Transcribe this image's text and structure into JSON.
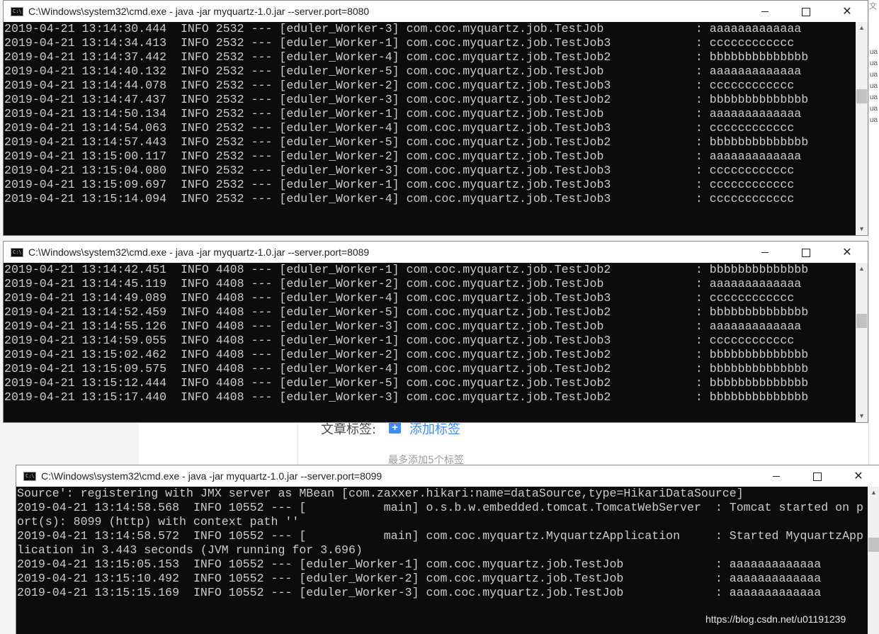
{
  "background": {
    "tags_label": "文章标签:",
    "add_tag_icon": "plus-icon",
    "add_tag_label": "添加标签",
    "tag_hint": "最多添加5个标签",
    "right_edge_crumb": "文",
    "right_edge_items": [
      "ua",
      "ua",
      "ua",
      "ua",
      "ua",
      "ua",
      "ua"
    ]
  },
  "windows": [
    {
      "title": "C:\\Windows\\system32\\cmd.exe - java  -jar myquartz-1.0.jar --server.port=8080",
      "lines": [
        "2019-04-21 13:14:30.444  INFO 2532 --- [eduler_Worker-3] com.coc.myquartz.job.TestJob             : aaaaaaaaaaaaa",
        "2019-04-21 13:14:34.413  INFO 2532 --- [eduler_Worker-1] com.coc.myquartz.job.TestJob3            : cccccccccccc",
        "2019-04-21 13:14:37.442  INFO 2532 --- [eduler_Worker-4] com.coc.myquartz.job.TestJob2            : bbbbbbbbbbbbbb",
        "2019-04-21 13:14:40.132  INFO 2532 --- [eduler_Worker-5] com.coc.myquartz.job.TestJob             : aaaaaaaaaaaaa",
        "2019-04-21 13:14:44.078  INFO 2532 --- [eduler_Worker-2] com.coc.myquartz.job.TestJob3            : cccccccccccc",
        "2019-04-21 13:14:47.437  INFO 2532 --- [eduler_Worker-3] com.coc.myquartz.job.TestJob2            : bbbbbbbbbbbbbb",
        "2019-04-21 13:14:50.134  INFO 2532 --- [eduler_Worker-1] com.coc.myquartz.job.TestJob             : aaaaaaaaaaaaa",
        "2019-04-21 13:14:54.063  INFO 2532 --- [eduler_Worker-4] com.coc.myquartz.job.TestJob3            : cccccccccccc",
        "2019-04-21 13:14:57.443  INFO 2532 --- [eduler_Worker-5] com.coc.myquartz.job.TestJob2            : bbbbbbbbbbbbbb",
        "2019-04-21 13:15:00.117  INFO 2532 --- [eduler_Worker-2] com.coc.myquartz.job.TestJob             : aaaaaaaaaaaaa",
        "2019-04-21 13:15:04.080  INFO 2532 --- [eduler_Worker-3] com.coc.myquartz.job.TestJob3            : cccccccccccc",
        "2019-04-21 13:15:09.697  INFO 2532 --- [eduler_Worker-1] com.coc.myquartz.job.TestJob3            : cccccccccccc",
        "2019-04-21 13:15:14.094  INFO 2532 --- [eduler_Worker-4] com.coc.myquartz.job.TestJob3            : cccccccccccc"
      ]
    },
    {
      "title": "C:\\Windows\\system32\\cmd.exe - java  -jar myquartz-1.0.jar --server.port=8089",
      "lines": [
        "2019-04-21 13:14:42.451  INFO 4408 --- [eduler_Worker-1] com.coc.myquartz.job.TestJob2            : bbbbbbbbbbbbbb",
        "2019-04-21 13:14:45.119  INFO 4408 --- [eduler_Worker-2] com.coc.myquartz.job.TestJob             : aaaaaaaaaaaaa",
        "2019-04-21 13:14:49.089  INFO 4408 --- [eduler_Worker-4] com.coc.myquartz.job.TestJob3            : cccccccccccc",
        "2019-04-21 13:14:52.459  INFO 4408 --- [eduler_Worker-5] com.coc.myquartz.job.TestJob2            : bbbbbbbbbbbbbb",
        "2019-04-21 13:14:55.126  INFO 4408 --- [eduler_Worker-3] com.coc.myquartz.job.TestJob             : aaaaaaaaaaaaa",
        "2019-04-21 13:14:59.055  INFO 4408 --- [eduler_Worker-1] com.coc.myquartz.job.TestJob3            : cccccccccccc",
        "2019-04-21 13:15:02.462  INFO 4408 --- [eduler_Worker-2] com.coc.myquartz.job.TestJob2            : bbbbbbbbbbbbbb",
        "2019-04-21 13:15:09.575  INFO 4408 --- [eduler_Worker-4] com.coc.myquartz.job.TestJob2            : bbbbbbbbbbbbbb",
        "2019-04-21 13:15:12.444  INFO 4408 --- [eduler_Worker-5] com.coc.myquartz.job.TestJob2            : bbbbbbbbbbbbbb",
        "2019-04-21 13:15:17.440  INFO 4408 --- [eduler_Worker-3] com.coc.myquartz.job.TestJob2            : bbbbbbbbbbbbbb"
      ]
    },
    {
      "title": "C:\\Windows\\system32\\cmd.exe - java  -jar myquartz-1.0.jar --server.port=8099",
      "lines": [
        "Source': registering with JMX server as MBean [com.zaxxer.hikari:name=dataSource,type=HikariDataSource]",
        "2019-04-21 13:14:58.568  INFO 10552 --- [           main] o.s.b.w.embedded.tomcat.TomcatWebServer  : Tomcat started on p",
        "ort(s): 8099 (http) with context path ''",
        "2019-04-21 13:14:58.572  INFO 10552 --- [           main] com.coc.myquartz.MyquartzApplication     : Started MyquartzApp",
        "lication in 3.443 seconds (JVM running for 3.696)",
        "2019-04-21 13:15:05.153  INFO 10552 --- [eduler_Worker-1] com.coc.myquartz.job.TestJob             : aaaaaaaaaaaaa",
        "2019-04-21 13:15:10.492  INFO 10552 --- [eduler_Worker-2] com.coc.myquartz.job.TestJob             : aaaaaaaaaaaaa",
        "2019-04-21 13:15:15.169  INFO 10552 --- [eduler_Worker-3] com.coc.myquartz.job.TestJob             : aaaaaaaaaaaaa"
      ]
    }
  ],
  "watermark": "https://blog.csdn.net/u01191239",
  "colors": {
    "console_bg": "#0c0c0c",
    "console_text": "#cccccc",
    "accent_blue": "#3d8bff"
  }
}
